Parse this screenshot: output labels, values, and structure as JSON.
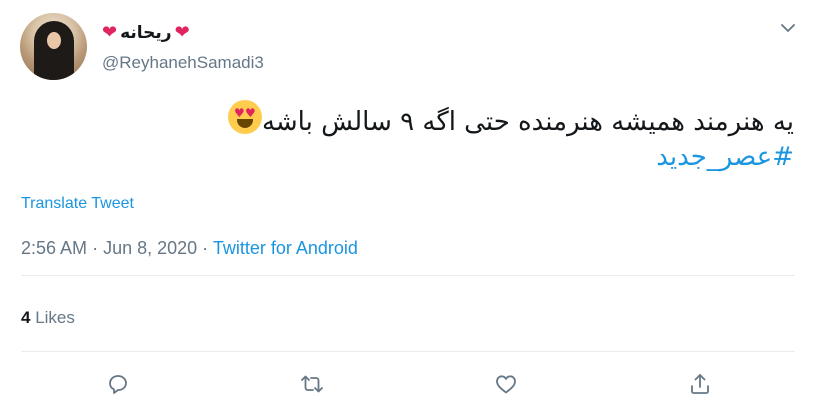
{
  "user": {
    "display_name": "ریحانه",
    "handle": "@ReyhanehSamadi3",
    "avatar_alt": "profile photo"
  },
  "tweet": {
    "text_line1": "یه هنرمند همیشه هنرمنده حتی اگه ۹ سالش باشه",
    "hashtag": "#عصر_جدید",
    "translate_label": "Translate Tweet",
    "time": "2:56 AM",
    "date": "Jun 8, 2020",
    "separator": "·",
    "source": "Twitter for Android"
  },
  "stats": {
    "likes_count": "4",
    "likes_label": "Likes"
  },
  "actions": {
    "reply": "reply-icon",
    "retweet": "retweet-icon",
    "like": "heart-icon",
    "share": "share-icon"
  },
  "colors": {
    "link": "#1b95e0",
    "muted": "#657786",
    "heart": "#e0245e",
    "text": "#14171a",
    "divider": "#e6ecf0"
  }
}
